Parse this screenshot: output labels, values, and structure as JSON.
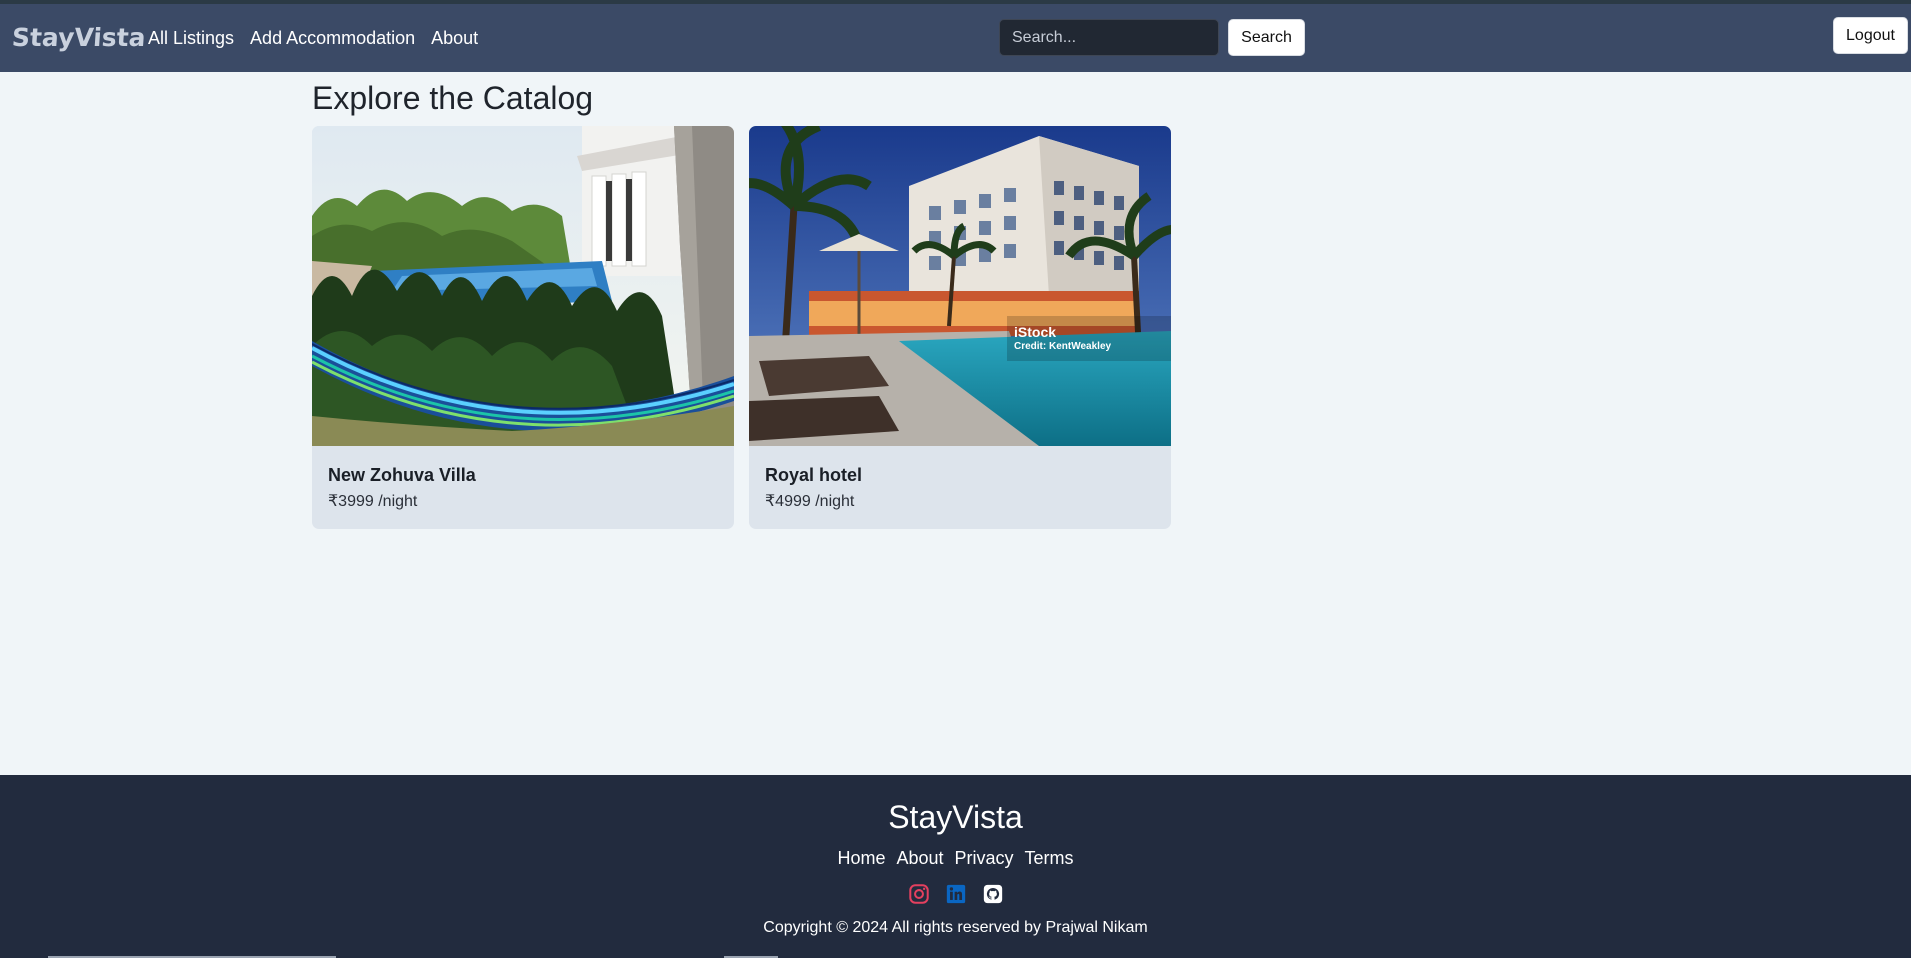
{
  "navbar": {
    "brand": "StayVista",
    "links": [
      "All Listings",
      "Add Accommodation",
      "About"
    ],
    "search_placeholder": "Search...",
    "search_button": "Search",
    "logout_button": "Logout"
  },
  "main": {
    "title": "Explore the Catalog",
    "listings": [
      {
        "title": "New Zohuva Villa",
        "price": "₹3999 /night"
      },
      {
        "title": "Royal hotel",
        "price": "₹4999 /night",
        "watermark": "iStock",
        "credit": "Credit: KentWeakley"
      }
    ]
  },
  "footer": {
    "brand": "StayVista",
    "links": [
      "Home",
      "About",
      "Privacy",
      "Terms"
    ],
    "social_icons": [
      "instagram-icon",
      "linkedin-icon",
      "github-icon"
    ],
    "copyright": "Copyright © 2024 All rights reserved by Prajwal Nikam"
  },
  "colors": {
    "navbar_bg": "#3b4a66",
    "page_bg": "#f0f5f8",
    "card_bg": "#dde4ec",
    "footer_bg": "#222b3e",
    "instagram": "#e4405f",
    "linkedin": "#0a66c2"
  }
}
